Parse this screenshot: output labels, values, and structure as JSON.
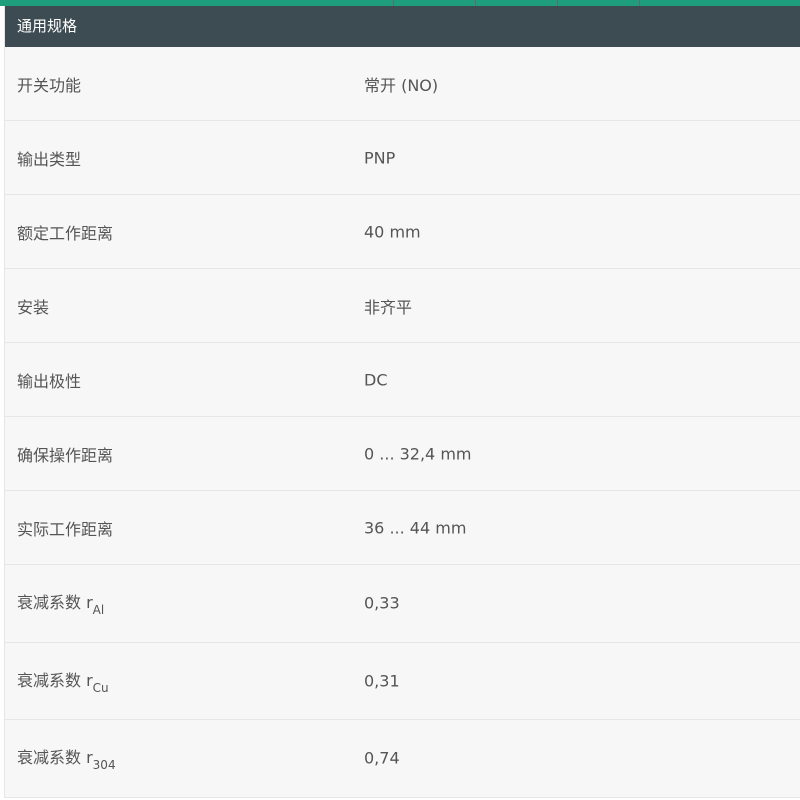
{
  "section": {
    "title": "通用规格"
  },
  "rows": [
    {
      "label": "开关功能",
      "value": "常开 (NO)"
    },
    {
      "label": "输出类型",
      "value": "PNP"
    },
    {
      "label": "额定工作距离",
      "value": "40 mm"
    },
    {
      "label": "安装",
      "value": "非齐平"
    },
    {
      "label": "输出极性",
      "value": "DC"
    },
    {
      "label": "确保操作距离",
      "value": "0 ... 32,4 mm"
    },
    {
      "label": "实际工作距离",
      "value": "36 ... 44 mm"
    },
    {
      "label": "衰减系数 r",
      "sub": "Al",
      "value": "0,33"
    },
    {
      "label": "衰减系数 r",
      "sub": "Cu",
      "value": "0,31"
    },
    {
      "label": "衰减系数 r",
      "sub": "304",
      "value": "0,74"
    }
  ],
  "colors": {
    "accent": "#1f9e7e",
    "header_bg": "#3d4c53",
    "row_bg": "#f7f7f7",
    "text": "#555555"
  }
}
